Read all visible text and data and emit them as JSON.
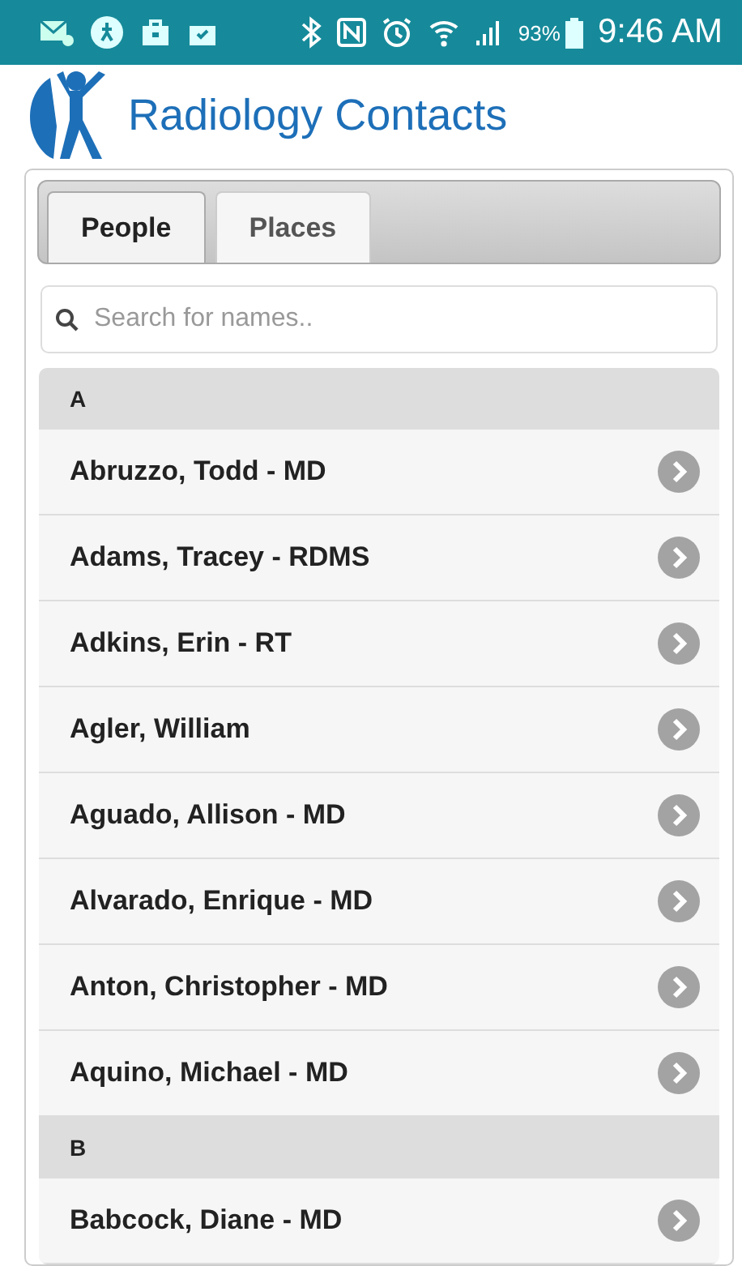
{
  "status_bar": {
    "battery": "93%",
    "time": "9:46 AM"
  },
  "header": {
    "title": "Radiology Contacts"
  },
  "tabs": [
    {
      "label": "People",
      "selected": true
    },
    {
      "label": "Places",
      "selected": false
    }
  ],
  "search": {
    "placeholder": "Search for names.."
  },
  "groups": [
    {
      "letter": "A",
      "contacts": [
        "Abruzzo, Todd - MD",
        "Adams, Tracey - RDMS",
        "Adkins, Erin - RT",
        "Agler, William",
        "Aguado, Allison - MD",
        "Alvarado, Enrique - MD",
        "Anton, Christopher - MD",
        "Aquino, Michael - MD"
      ]
    },
    {
      "letter": "B",
      "contacts": [
        "Babcock, Diane - MD"
      ]
    }
  ]
}
